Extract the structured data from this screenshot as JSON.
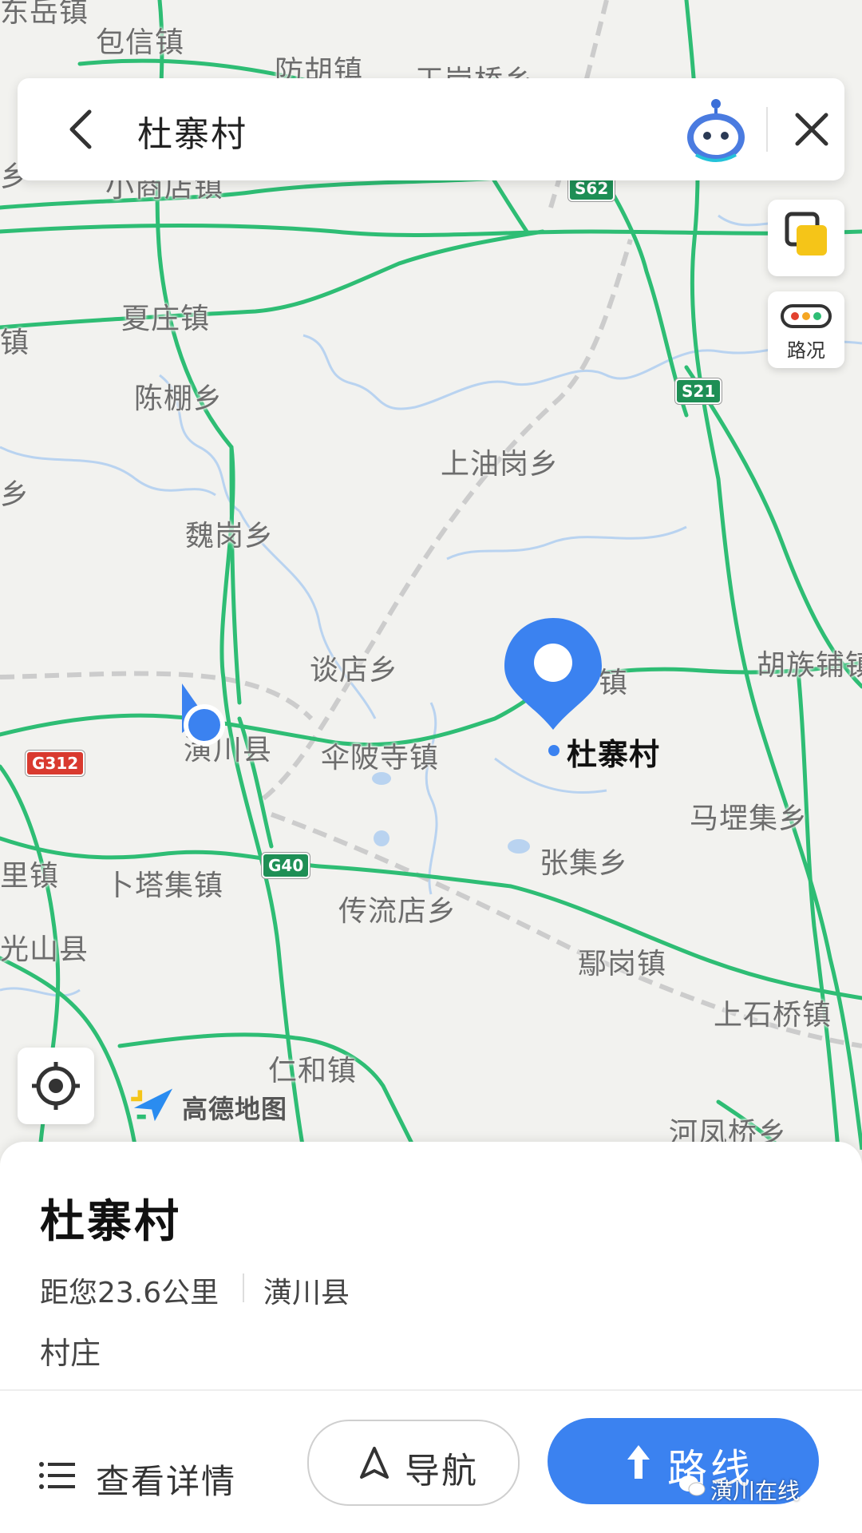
{
  "search": {
    "query": "杜寨村"
  },
  "controls": {
    "traffic_label": "路况"
  },
  "map": {
    "places": [
      "东岳镇",
      "包信镇",
      "防胡镇",
      "王岗桥乡",
      "乡",
      "小商店镇",
      "夏庄镇",
      "镇",
      "陈棚乡",
      "上油岗乡",
      "乡",
      "魏岗乡",
      "谈店乡",
      "镇",
      "胡族铺镇",
      "潢川县",
      "伞陂寺镇",
      "马堽集乡",
      "张集乡",
      "里镇",
      "卜塔集镇",
      "传流店乡",
      "光山县",
      "鄢岗镇",
      "上石桥镇",
      "仁和镇",
      "河凤桥乡",
      "杜寨村"
    ],
    "roads": [
      "S62",
      "S21",
      "G312",
      "G40"
    ],
    "logo_text": "高德地图"
  },
  "place": {
    "name": "杜寨村",
    "distance": "距您23.6公里",
    "county": "潢川县",
    "type": "村庄"
  },
  "actions": {
    "details_label": "查看详情",
    "navigate_label": "导航",
    "route_label": "路线"
  },
  "watermark": "潢川在线",
  "colors": {
    "road_green": "#2ebd74",
    "accent_blue": "#3b82f0",
    "map_bg": "#f2f2ef",
    "river": "#b9d3f0"
  }
}
